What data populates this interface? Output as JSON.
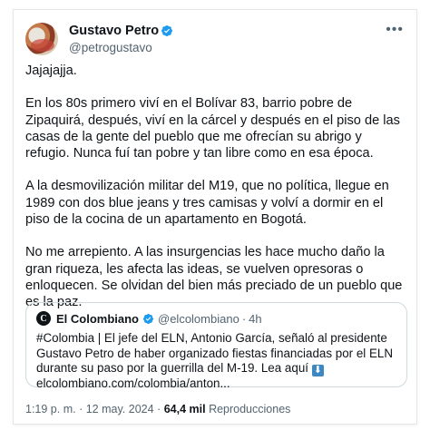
{
  "author": {
    "display_name": "Gustavo Petro",
    "handle": "@petrogustavo"
  },
  "menu_icon": "more-horizontal-icon",
  "verified_color": "#1d9bf0",
  "tweet": {
    "paragraphs": [
      "Jajajajja.",
      "En los 80s primero viví en el Bolívar 83, barrio pobre de Zipaquirá, después, viví en la cárcel y después en el piso de las casas de la gente del pueblo que me ofrecían su abrigo y refugio. Nunca fuí tan pobre y tan libre como en esa época.",
      "A la desmovilización militar del M19, que no política, llegue en 1989 con dos blue jeans y tres camisas y volví a dormir en el piso de la cocina de un apartamento en Bogotá.",
      "No me arrepiento. A las insurgencias les hace mucho daño la gran riqueza, les afecta las ideas, se vuelven opresoras o enloquecen. Se olvidan del bien más preciado de un pueblo que es la paz."
    ]
  },
  "quoted": {
    "logo": "C",
    "name": "El Colombiano",
    "handle": "@elcolombiano",
    "separator": "·",
    "time": "4h",
    "text_main": "#Colombia | El jefe del ELN, Antonio García, señaló al presidente Gustavo Petro de haber organizado fiestas financiadas por el ELN durante su paso por la guerrilla del M-19. Lea aquí",
    "arrow": "⬇",
    "link": "elcolombiano.com/colombia/anton..."
  },
  "meta": {
    "time": "1:19 p. m.",
    "separator": "·",
    "date": "12 may. 2024",
    "views": "64,4 mil",
    "views_label": "Reproducciones"
  }
}
